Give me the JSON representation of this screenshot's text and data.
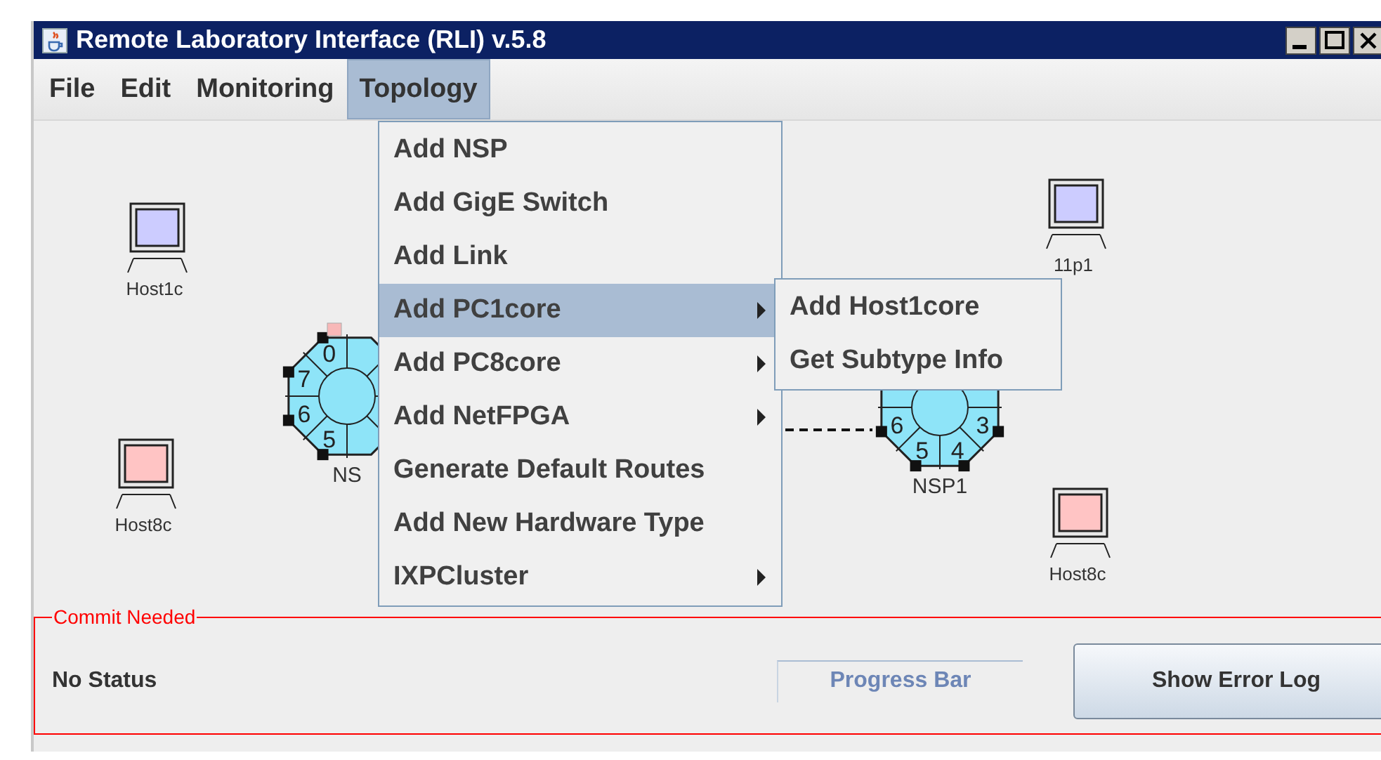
{
  "window": {
    "title": "Remote Laboratory Interface (RLI) v.5.8"
  },
  "menu_bar": [
    {
      "label": "File",
      "selected": false
    },
    {
      "label": "Edit",
      "selected": false
    },
    {
      "label": "Monitoring",
      "selected": false
    },
    {
      "label": "Topology",
      "selected": true
    }
  ],
  "topology": {
    "hosts": [
      {
        "label": "Host1c",
        "color": "#ccccff"
      },
      {
        "label": "Host8c",
        "color": "#ffc4c4"
      },
      {
        "label": "11p1",
        "color": "#ccccff"
      },
      {
        "label": "Host8c",
        "color": "#ffc4c4"
      }
    ],
    "nsps": [
      {
        "label": "NS",
        "ports": [
          "5",
          "6",
          "7",
          "0"
        ]
      },
      {
        "label": "NSP1",
        "ports": [
          "3",
          "4",
          "5",
          "6"
        ]
      }
    ]
  },
  "open_menu": {
    "items": [
      {
        "label": "Add NSP",
        "submenu": false,
        "selected": false
      },
      {
        "label": "Add GigE Switch",
        "submenu": false,
        "selected": false
      },
      {
        "label": "Add Link",
        "submenu": false,
        "selected": false
      },
      {
        "label": "Add PC1core",
        "submenu": true,
        "selected": true
      },
      {
        "label": "Add PC8core",
        "submenu": true,
        "selected": false
      },
      {
        "label": "Add NetFPGA",
        "submenu": true,
        "selected": false
      },
      {
        "label": "Generate Default Routes",
        "submenu": false,
        "selected": false
      },
      {
        "label": "Add New Hardware Type",
        "submenu": false,
        "selected": false
      },
      {
        "label": "IXPCluster",
        "submenu": true,
        "selected": false
      }
    ]
  },
  "submenu": {
    "items": [
      {
        "label": "Add Host1core",
        "selected": false
      },
      {
        "label": "Get Subtype Info",
        "selected": false
      }
    ]
  },
  "status_panel": {
    "title": "Commit Needed",
    "status": "No Status",
    "progress": {
      "label": "Progress Bar"
    },
    "button": "Show Error Log"
  }
}
